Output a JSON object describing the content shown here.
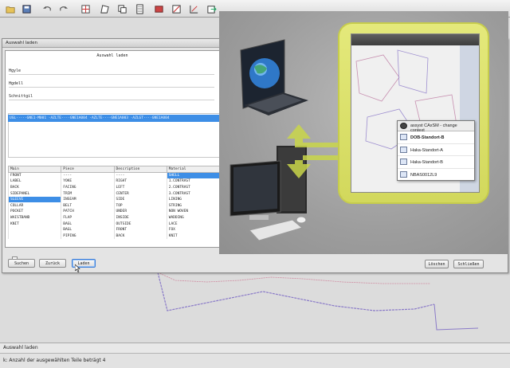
{
  "toolbar": {
    "buttons": [
      "folder-open",
      "save",
      "undo",
      "redo",
      "grid",
      "piece",
      "copy",
      "document",
      "layers",
      "grading",
      "dimension",
      "export",
      "tag"
    ]
  },
  "dialog": {
    "title": "Auswahl laden",
    "section_header": "Auswahl laden",
    "fields": [
      "Hgyle",
      "Hgdell",
      "Schnittgil"
    ],
    "selection_row": "UGL·····GNE1·M001  ·AZLTE····GNE1A004  ·AZLTE····GNE1A003  ·AZLGT····GNE1A004",
    "columns": [
      "Main",
      "Piece",
      "Description",
      "Material"
    ],
    "rows": [
      [
        "FRONT",
        "----",
        "----",
        "SHELL"
      ],
      [
        "LABEL",
        "YOKE",
        "RIGHT",
        "1.CONTRAST"
      ],
      [
        "BACK",
        "FACING",
        "LEFT",
        "2.CONTRAST"
      ],
      [
        "SIDEPANEL",
        "TRIM",
        "CENTER",
        "3.CONTRAST"
      ],
      [
        "SLEEVE",
        "INSEAM",
        "SIDE",
        "LINING"
      ],
      [
        "COLLAR",
        "BELT",
        "TOP",
        "STRING"
      ],
      [
        "POCKET",
        "PATCH",
        "UNDER",
        "NON WOVEN"
      ],
      [
        "WAISTBAND",
        "FLAP",
        "INSIDE",
        "WADDING"
      ],
      [
        "KNIT",
        "BAGL",
        "OUTSIDE",
        "LACE"
      ],
      [
        "",
        "BAGL",
        "FRONT",
        "FOX"
      ],
      [
        "",
        "PIPING",
        "BACK",
        "KNIT"
      ]
    ],
    "highlight_row": 4,
    "buttons": {
      "search": "Suchen",
      "reset": "Zurück",
      "load": "Laden"
    }
  },
  "right_buttons": {
    "lower": "Löschen",
    "close": "Schließen"
  },
  "context_menu": {
    "title": "assyst CAxSM - change context",
    "items": [
      "DOB-Standort-B",
      "Haka-Standort-A",
      "Haka-Standort-B",
      "NBAS0012L9"
    ],
    "active_index": 0
  },
  "status": {
    "title": "Auswahl laden",
    "message": "k: Anzahl der ausgewählten Teile beträgt 4"
  },
  "colors": {
    "selection": "#3d8ee6",
    "tablet_frame": "#d8de66",
    "arrow": "#c9d64a"
  }
}
